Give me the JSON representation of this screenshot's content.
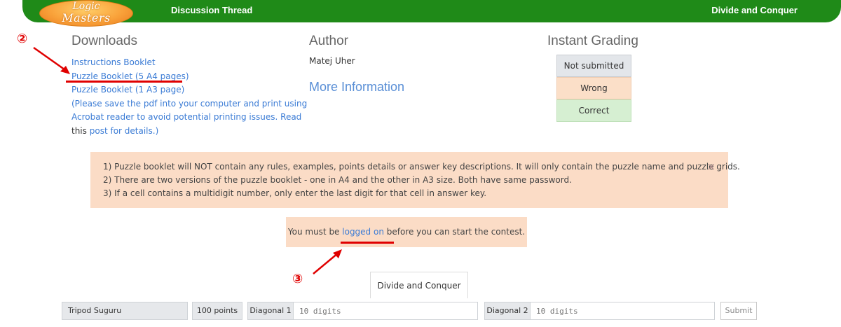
{
  "header": {
    "logo_line1": "Logic",
    "logo_line2": "Masters",
    "nav_left": "Discussion Thread",
    "nav_right": "Divide and Conquer"
  },
  "downloads": {
    "heading": "Downloads",
    "links": [
      "Instructions Booklet",
      "Puzzle Booklet (5 A4 pages)",
      "Puzzle Booklet (1 A3 page)"
    ],
    "note_line1": "(Please save the pdf into your computer and print using",
    "note_line2": "Acrobat reader to avoid potential printing issues. Read",
    "note_this": "this",
    "note_link": "post for details.)"
  },
  "author": {
    "heading": "Author",
    "name": "Matej Uher",
    "more_info": "More Information"
  },
  "grading": {
    "heading": "Instant Grading",
    "not_submitted": "Not submitted",
    "wrong": "Wrong",
    "correct": "Correct"
  },
  "notice": {
    "lines": [
      "1) Puzzle booklet will NOT contain any rules, examples, points details or answer key descriptions. It will only contain the puzzle name and puzzle grids.",
      "2) There are two versions of the puzzle booklet - one in A4 and the other in A3 size. Both have same password.",
      "3) If a cell contains a multidigit number, only enter the last digit for that cell in answer key."
    ],
    "close": "×"
  },
  "login": {
    "before": "You must be ",
    "link": "logged on",
    "after": " before you can start the contest."
  },
  "annotations": {
    "num2": "②",
    "num3": "③",
    "color": "#e00000"
  },
  "tab": {
    "label": "Divide and Conquer"
  },
  "answer_row": {
    "puzzle_name": "Tripod Suguru",
    "points": "100 points",
    "diag1_label": "Diagonal 1",
    "diag1_placeholder": "10 digits",
    "diag2_label": "Diagonal 2",
    "diag2_placeholder": "10 digits",
    "submit": "Submit"
  },
  "colors": {
    "header_green": "#1f8a18",
    "link_blue": "#3a7bd5",
    "notice_bg": "#fbdcc6"
  }
}
